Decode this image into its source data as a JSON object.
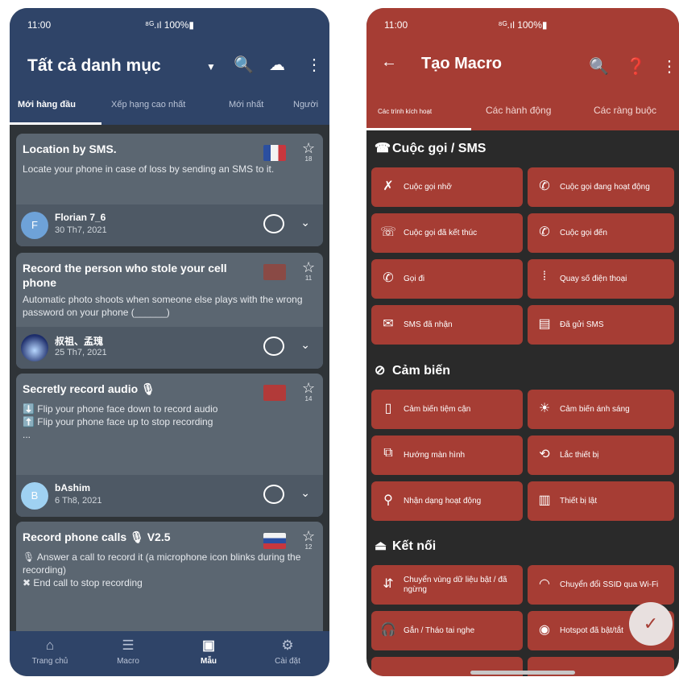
{
  "left": {
    "status": {
      "time": "11:00",
      "signal": "⁸ᴳ.ıl 100%▮"
    },
    "header": {
      "title": "Tất cả danh mục"
    },
    "tabs": [
      "Mới hàng đầu",
      "Xếp hạng cao nhất",
      "Mới nhất",
      "Người"
    ],
    "cards": [
      {
        "title": "Location by SMS.",
        "desc": "Locate your phone in case of loss by sending an SMS to it.",
        "stars": "18",
        "author": "Florian 7_6",
        "date": "30 Th7, 2021",
        "avatar": "F"
      },
      {
        "title": "Record the person who stole your cell phone",
        "desc": "Automatic photo shoots when someone else plays with the wrong password on your phone (______)",
        "stars": "11",
        "author": "叔祖、孟瑰",
        "date": "25 Th7, 2021",
        "avatar": ""
      },
      {
        "title": "Secretly record audio 🎙",
        "desc": "⬇️ Flip your phone face down to record audio\n⬆️ Flip your phone face up to stop recording\n...",
        "stars": "14",
        "author": "bAshim",
        "date": "6 Th8, 2021",
        "avatar": "B"
      },
      {
        "title": "Record phone calls   🎙 V2.5",
        "desc": "🎙 Answer a call to record it (a microphone icon blinks during the recording)\n✖ End call to stop recording",
        "stars": "12",
        "author": "",
        "date": "",
        "avatar": ""
      }
    ],
    "nav": [
      "Trang chủ",
      "Macro",
      "Mẫu",
      "Cài đặt"
    ]
  },
  "right": {
    "status": {
      "time": "11:00",
      "signal": "⁸ᴳ.ıl 100%▮"
    },
    "header": {
      "title": "Tạo Macro"
    },
    "tabs": [
      "Các trình kích hoạt",
      "Các hành động",
      "Các ràng buộc"
    ],
    "sections": [
      {
        "title": "Cuộc gọi / SMS",
        "items": [
          "Cuộc gọi nhỡ",
          "Cuộc gọi đang hoạt động",
          "Cuộc gọi đã kết thúc",
          "Cuộc gọi đến",
          "Gọi đi",
          "Quay số điện thoại",
          "SMS đã nhận",
          "Đã gửi SMS"
        ]
      },
      {
        "title": "Cảm biến",
        "items": [
          "Cảm biến tiệm cận",
          "Cảm biến ánh sáng",
          "Hướng màn hình",
          "Lắc thiết bị",
          "Nhận dạng hoạt động",
          "Thiết bị lật"
        ]
      },
      {
        "title": "Kết nối",
        "items": [
          "Chuyển vùng dữ liệu bật / đã ngừng",
          "Chuyển đổi SSID qua Wi-Fi",
          "Gắn / Tháo tai nghe",
          "Hotspot đã bật/tắt"
        ]
      }
    ]
  },
  "colors": {
    "left_accent": "#2f4468",
    "right_accent": "#a63d34"
  }
}
